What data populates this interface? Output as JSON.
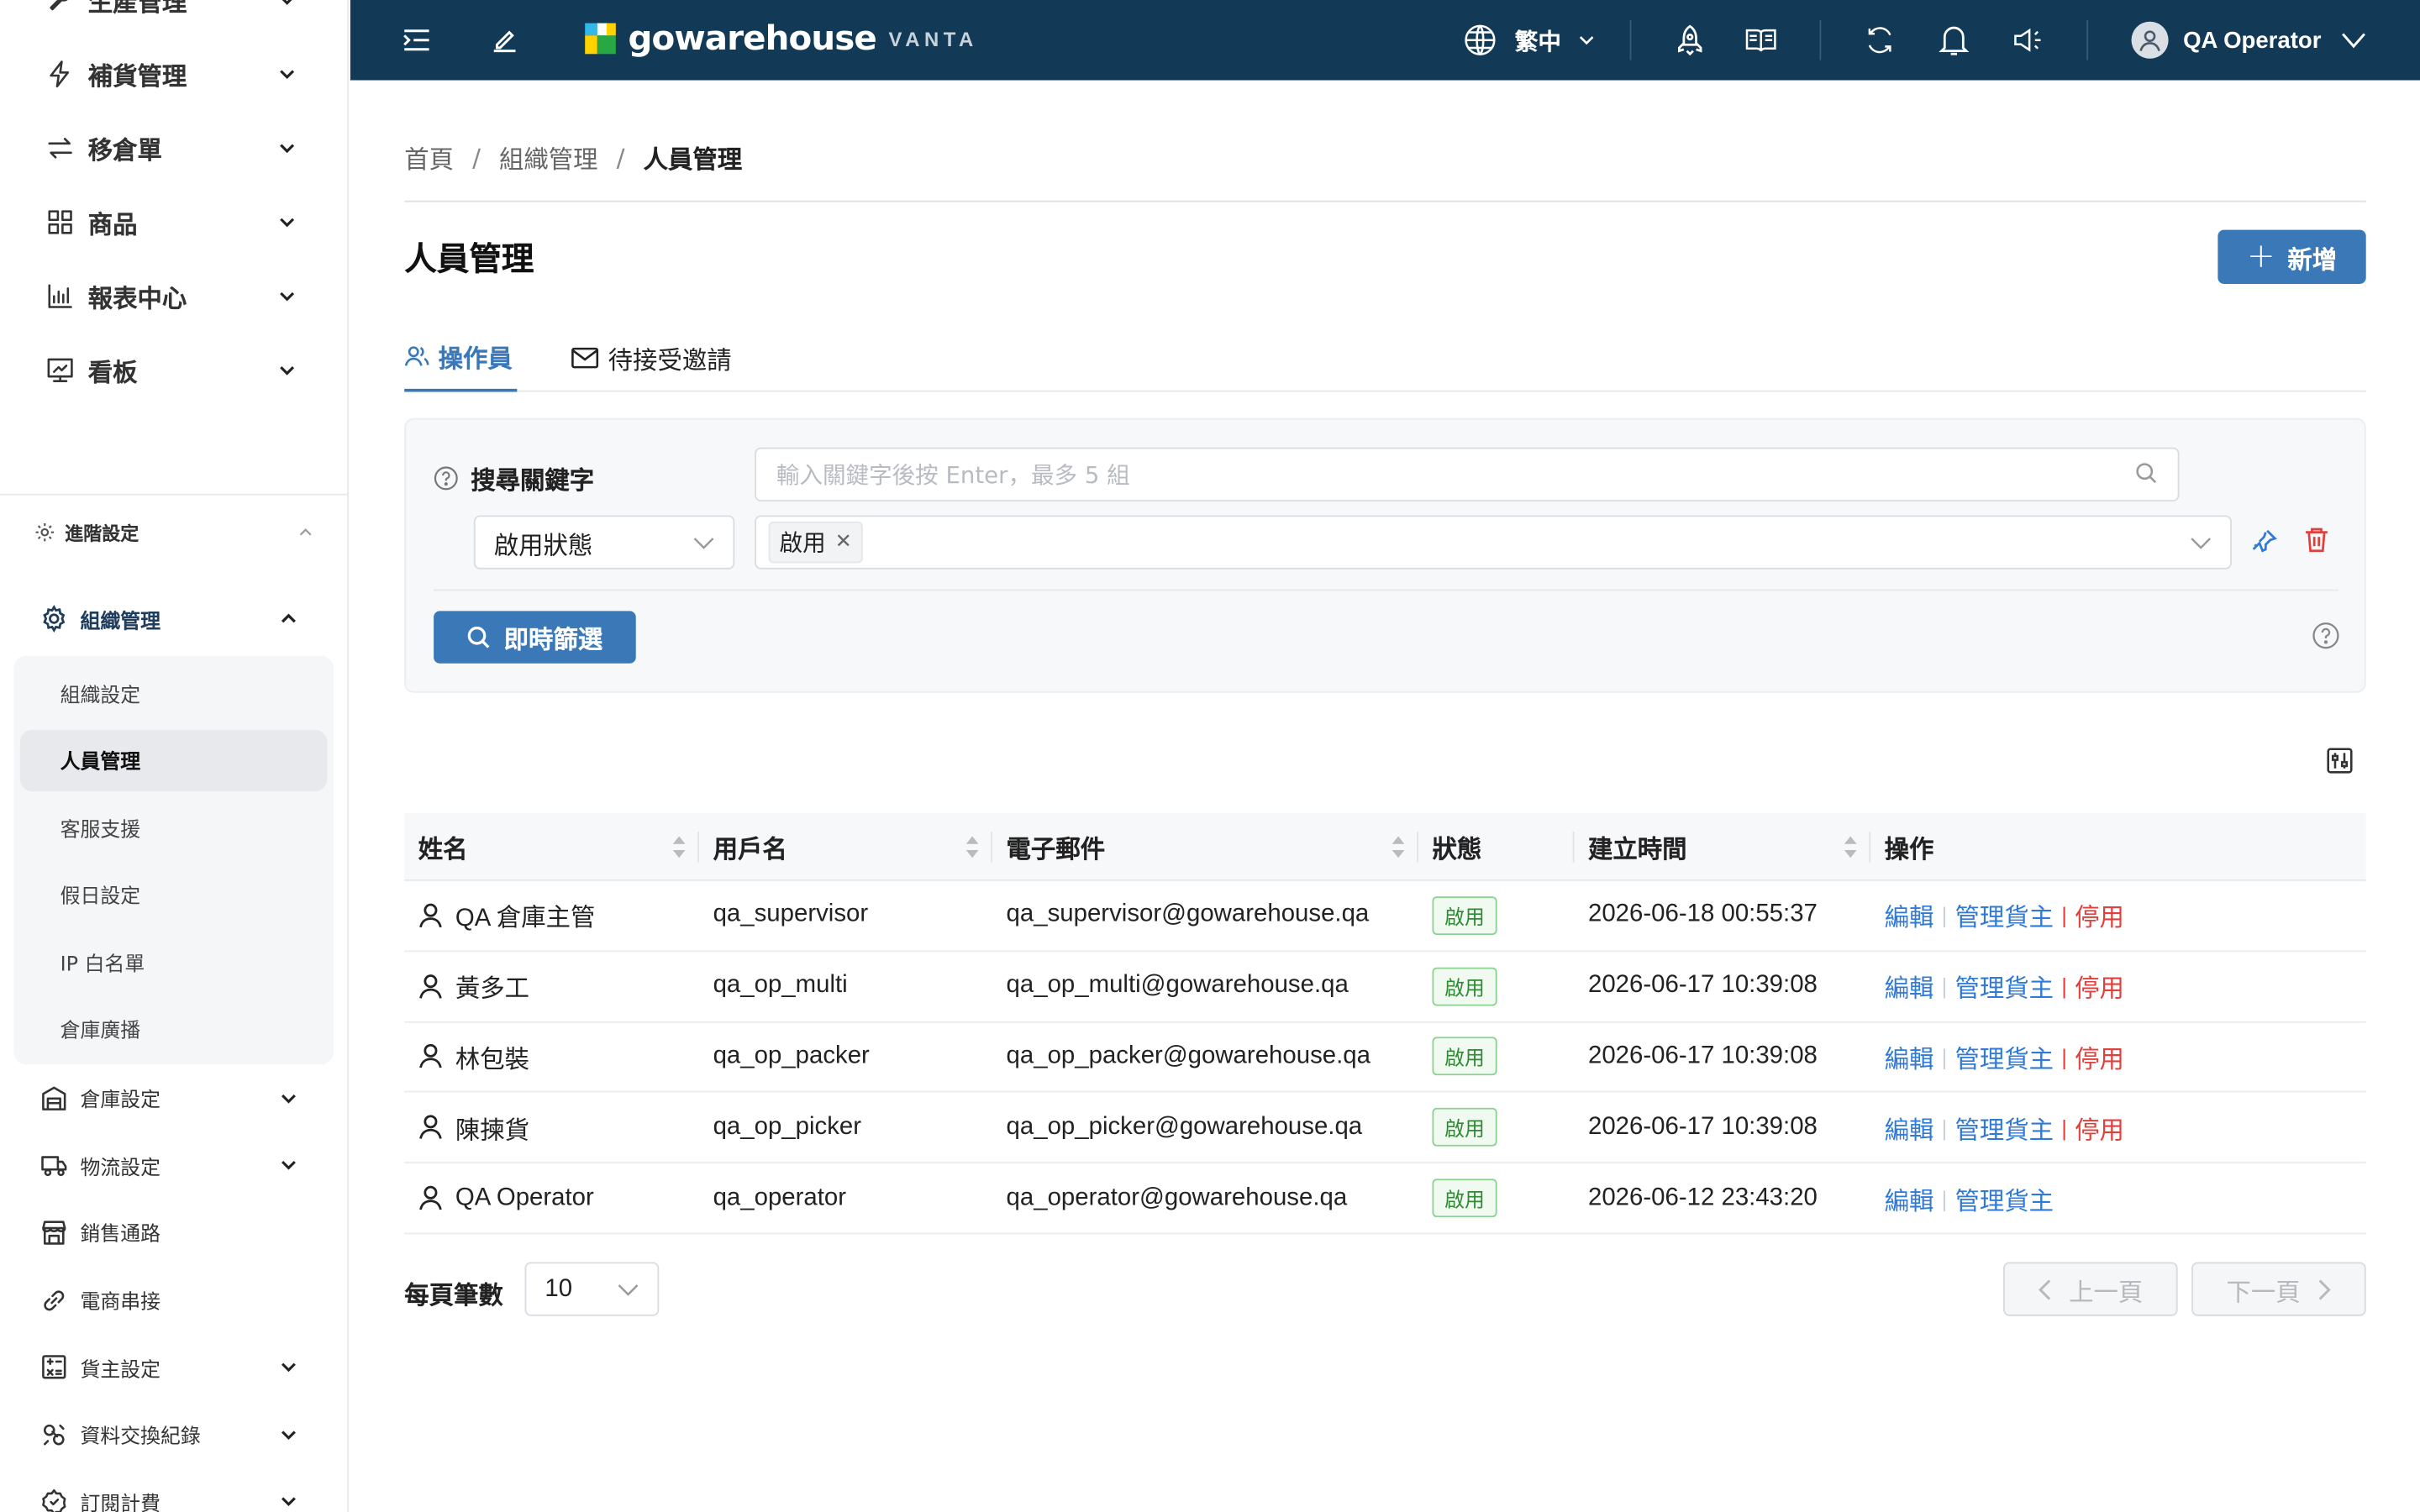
{
  "colors": {
    "topbar": "#123a56",
    "primary": "#3a78b7",
    "link": "#2f7ad6",
    "danger": "#e0403c",
    "success": "#2e8a33"
  },
  "sidebar": {
    "top_items": [
      {
        "label": "生產管理",
        "icon": "tool-icon"
      },
      {
        "label": "補貨管理",
        "icon": "lightning-icon"
      },
      {
        "label": "移倉單",
        "icon": "transfer-icon"
      },
      {
        "label": "商品",
        "icon": "grid-icon"
      },
      {
        "label": "報表中心",
        "icon": "bar-chart-icon"
      },
      {
        "label": "看板",
        "icon": "dashboard-icon"
      }
    ],
    "advanced_label": "進階設定",
    "org_group_label": "組織管理",
    "org_items": [
      "組織設定",
      "人員管理",
      "客服支援",
      "假日設定",
      "IP 白名單",
      "倉庫廣播"
    ],
    "bottom_items": [
      {
        "label": "倉庫設定",
        "icon": "warehouse-icon",
        "has_children": true
      },
      {
        "label": "物流設定",
        "icon": "truck-icon",
        "has_children": true
      },
      {
        "label": "銷售通路",
        "icon": "store-icon",
        "has_children": false
      },
      {
        "label": "電商串接",
        "icon": "link-icon",
        "has_children": false
      },
      {
        "label": "貨主設定",
        "icon": "calculator-icon",
        "has_children": true
      },
      {
        "label": "資料交換紀錄",
        "icon": "exchange-icon",
        "has_children": true
      },
      {
        "label": "訂閱計費",
        "icon": "billing-icon",
        "has_children": true
      }
    ]
  },
  "topbar": {
    "brand": "gowarehouse",
    "brand_sub": "VANTA",
    "language": "繁中",
    "user": "QA Operator"
  },
  "breadcrumb": {
    "home": "首頁",
    "parent": "組織管理",
    "current": "人員管理"
  },
  "page": {
    "title": "人員管理",
    "add_label": "新增"
  },
  "tabs": [
    {
      "label": "操作員",
      "active": true
    },
    {
      "label": "待接受邀請",
      "active": false
    }
  ],
  "filter": {
    "keyword_label": "搜尋關鍵字",
    "keyword_placeholder": "輸入關鍵字後按 Enter，最多 5 組",
    "field_select": "啟用狀態",
    "tag": "啟用",
    "apply_label": "即時篩選"
  },
  "table": {
    "headers": {
      "name": "姓名",
      "username": "用戶名",
      "email": "電子郵件",
      "status": "狀態",
      "created": "建立時間",
      "actions": "操作"
    },
    "action_labels": {
      "edit": "編輯",
      "owners": "管理貨主",
      "disable": "停用"
    },
    "rows": [
      {
        "name": "QA 倉庫主管",
        "username": "qa_supervisor",
        "email": "qa_supervisor@gowarehouse.qa",
        "status": "啟用",
        "created": "2026-06-18 00:55:37",
        "can_disable": true
      },
      {
        "name": "黃多工",
        "username": "qa_op_multi",
        "email": "qa_op_multi@gowarehouse.qa",
        "status": "啟用",
        "created": "2026-06-17 10:39:08",
        "can_disable": true
      },
      {
        "name": "林包裝",
        "username": "qa_op_packer",
        "email": "qa_op_packer@gowarehouse.qa",
        "status": "啟用",
        "created": "2026-06-17 10:39:08",
        "can_disable": true
      },
      {
        "name": "陳揀貨",
        "username": "qa_op_picker",
        "email": "qa_op_picker@gowarehouse.qa",
        "status": "啟用",
        "created": "2026-06-17 10:39:08",
        "can_disable": true
      },
      {
        "name": "QA Operator",
        "username": "qa_operator",
        "email": "qa_operator@gowarehouse.qa",
        "status": "啟用",
        "created": "2026-06-12 23:43:20",
        "can_disable": false
      }
    ]
  },
  "pagination": {
    "per_page_label": "每頁筆數",
    "per_page": "10",
    "prev_label": "上一頁",
    "next_label": "下一頁"
  }
}
